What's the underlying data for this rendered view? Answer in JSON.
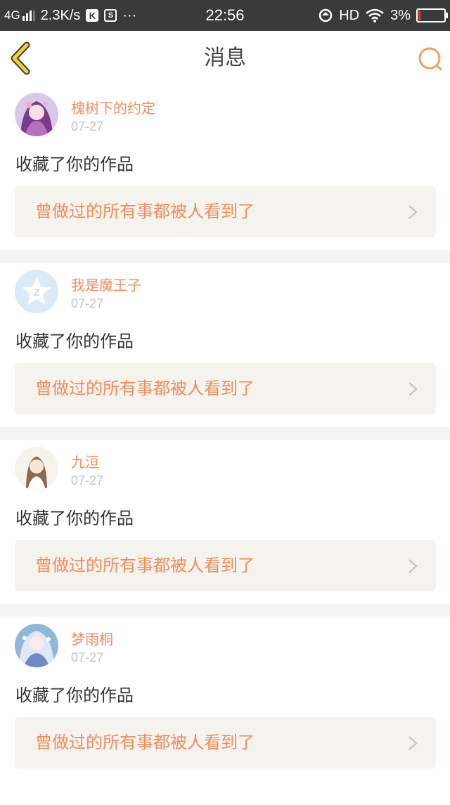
{
  "status_bar": {
    "network": "4G",
    "speed": "2.3K/s",
    "app_icon_k": "K",
    "app_icon_s": "S",
    "more": "···",
    "time": "22:56",
    "hd": "HD",
    "battery": "3%"
  },
  "header": {
    "title": "消息",
    "back_icon": "chevron-left-icon",
    "search_icon": "search-icon",
    "accent_color": "#f0a060"
  },
  "messages": [
    {
      "username": "槐树下的约定",
      "date": "07-27",
      "action": "收藏了你的作品",
      "work_title": "曾做过的所有事都被人看到了"
    },
    {
      "username": "我是魔王子",
      "date": "07-27",
      "action": "收藏了你的作品",
      "work_title": "曾做过的所有事都被人看到了"
    },
    {
      "username": "九洹",
      "date": "07-27",
      "action": "收藏了你的作品",
      "work_title": "曾做过的所有事都被人看到了"
    },
    {
      "username": "梦雨桐",
      "date": "07-27",
      "action": "收藏了你的作品",
      "work_title": "曾做过的所有事都被人看到了"
    }
  ],
  "colors": {
    "name_text": "#ee8d5e",
    "date_text": "#c4c4c4",
    "work_bg": "#f4f3ee",
    "separator": "#f4f4f4"
  }
}
